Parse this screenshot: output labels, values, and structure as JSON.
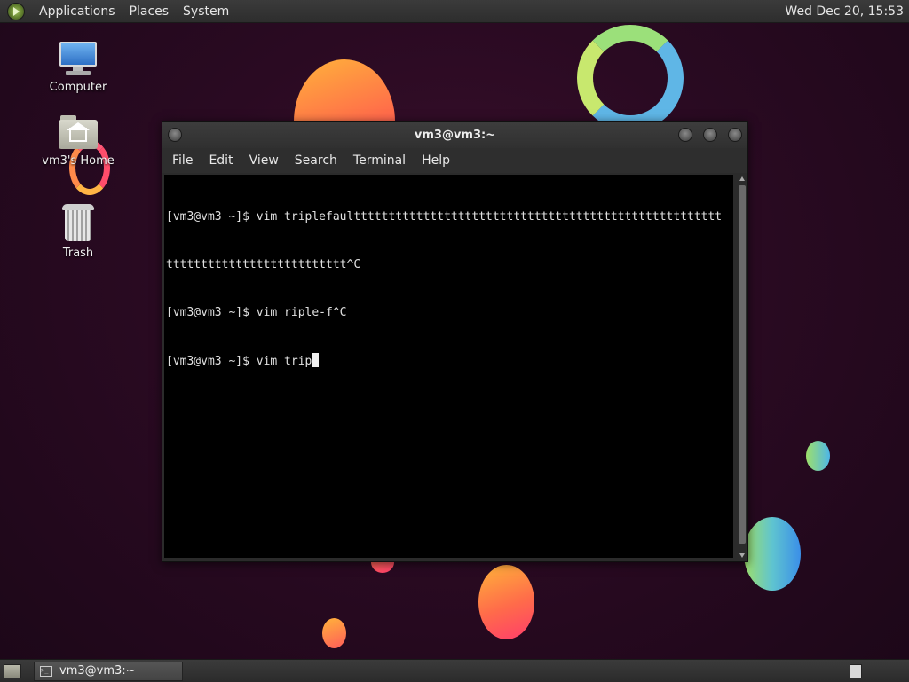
{
  "top_panel": {
    "menus": [
      "Applications",
      "Places",
      "System"
    ],
    "clock": "Wed Dec 20, 15:53"
  },
  "desktop_icons": [
    {
      "label": "Computer",
      "icon": "computer-icon"
    },
    {
      "label": "vm3's Home",
      "icon": "home-folder-icon"
    },
    {
      "label": "Trash",
      "icon": "trash-icon"
    }
  ],
  "terminal": {
    "title": "vm3@vm3:~",
    "menus": [
      "File",
      "Edit",
      "View",
      "Search",
      "Terminal",
      "Help"
    ],
    "lines": [
      "[vm3@vm3 ~]$ vim triplefaulttttttttttttttttttttttttttttttttttttttttttttttttttttt",
      "tttttttttttttttttttttttttt^C",
      "[vm3@vm3 ~]$ vim riple-f^C",
      "[vm3@vm3 ~]$ vim trip"
    ]
  },
  "bottom_panel": {
    "task_label": "vm3@vm3:~"
  },
  "colors": {
    "panel": "#333333",
    "terminal_bg": "#000000",
    "terminal_text": "#e0e0e0"
  }
}
